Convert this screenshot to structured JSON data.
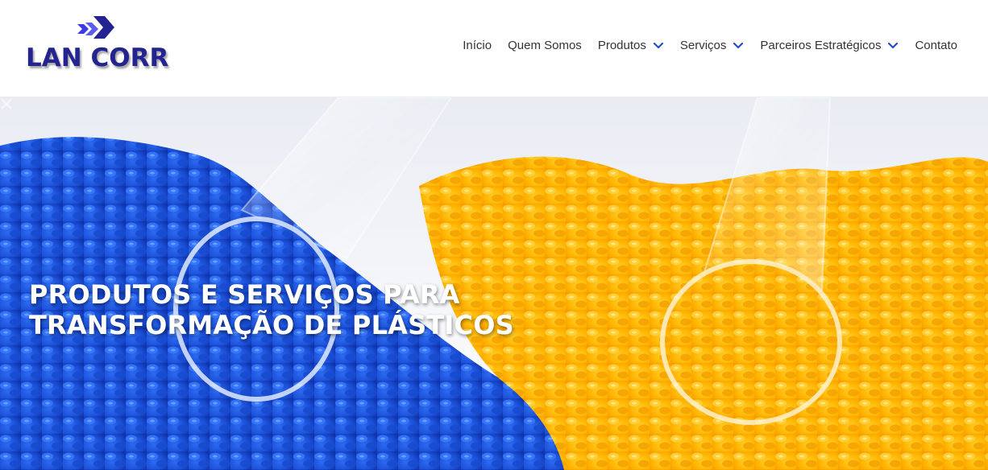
{
  "brand": {
    "name": "LAN CORR",
    "logo_color": "#23248f",
    "accent_color": "#3b3de0"
  },
  "nav": {
    "items": [
      {
        "label": "Início",
        "has_dropdown": false
      },
      {
        "label": "Quem Somos",
        "has_dropdown": false
      },
      {
        "label": "Produtos",
        "has_dropdown": true
      },
      {
        "label": "Serviços",
        "has_dropdown": true
      },
      {
        "label": "Parceiros Estratégicos",
        "has_dropdown": true
      },
      {
        "label": "Contato",
        "has_dropdown": false
      }
    ],
    "text_color": "#333333",
    "chevron_color": "#1f4fd1"
  },
  "hero": {
    "title_line1": "PRODUTOS E SERVIÇOS PARA",
    "title_line2": "TRANSFORMAÇÃO DE PLÁSTICOS",
    "left_pellet_color": "#1f4fd8",
    "right_pellet_color": "#ffb400",
    "prev_icon": "chevron-left-icon",
    "next_icon": "chevron-right-icon"
  }
}
